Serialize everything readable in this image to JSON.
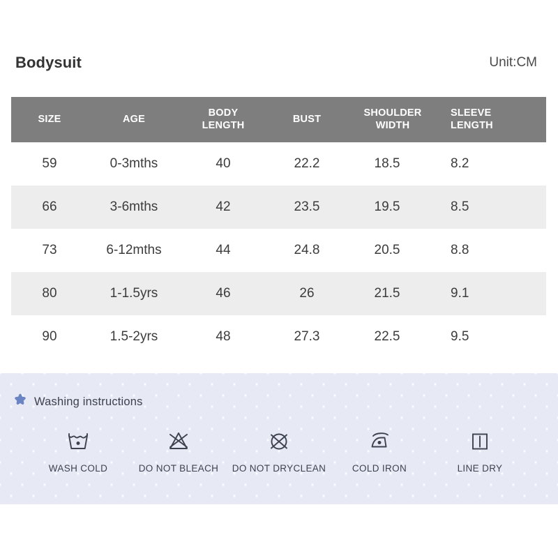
{
  "header": {
    "product_title": "Bodysuit",
    "unit_label": "Unit:CM"
  },
  "size_table": {
    "columns": [
      {
        "key": "size",
        "label_line1": "SIZE",
        "label_line2": ""
      },
      {
        "key": "age",
        "label_line1": "AGE",
        "label_line2": ""
      },
      {
        "key": "body",
        "label_line1": "BODY",
        "label_line2": "LENGTH"
      },
      {
        "key": "bust",
        "label_line1": "BUST",
        "label_line2": ""
      },
      {
        "key": "shoul",
        "label_line1": "SHOULDER",
        "label_line2": "WIDTH"
      },
      {
        "key": "sleeve",
        "label_line1": "SLEEVE",
        "label_line2": "LENGTH"
      }
    ],
    "rows": [
      {
        "size": "59",
        "age": "0-3mths",
        "body": "40",
        "bust": "22.2",
        "shoul": "18.5",
        "sleeve": "8.2"
      },
      {
        "size": "66",
        "age": "3-6mths",
        "body": "42",
        "bust": "23.5",
        "shoul": "19.5",
        "sleeve": "8.5"
      },
      {
        "size": "73",
        "age": "6-12mths",
        "body": "44",
        "bust": "24.8",
        "shoul": "20.5",
        "sleeve": "8.8"
      },
      {
        "size": "80",
        "age": "1-1.5yrs",
        "body": "46",
        "bust": "26",
        "shoul": "21.5",
        "sleeve": "9.1"
      },
      {
        "size": "90",
        "age": "1.5-2yrs",
        "body": "48",
        "bust": "27.3",
        "shoul": "22.5",
        "sleeve": "9.5"
      }
    ],
    "header_bg": "#7e7e7e",
    "header_text_color": "#ffffff",
    "alt_row_bg": "#ededed"
  },
  "washing": {
    "star_icon": "star-icon",
    "title": "Washing instructions",
    "panel_bg": "#e7eaf4",
    "star_color": "#6b85c4",
    "items": [
      {
        "icon": "wash-tub-cold-icon",
        "caption": "WASH COLD"
      },
      {
        "icon": "no-bleach-triangle-icon",
        "caption": "DO NOT BLEACH"
      },
      {
        "icon": "no-dryclean-circle-icon",
        "caption": "DO NOT DRYCLEAN"
      },
      {
        "icon": "iron-cold-icon",
        "caption": "COLD IRON"
      },
      {
        "icon": "line-dry-square-icon",
        "caption": "LINE DRY"
      }
    ]
  }
}
